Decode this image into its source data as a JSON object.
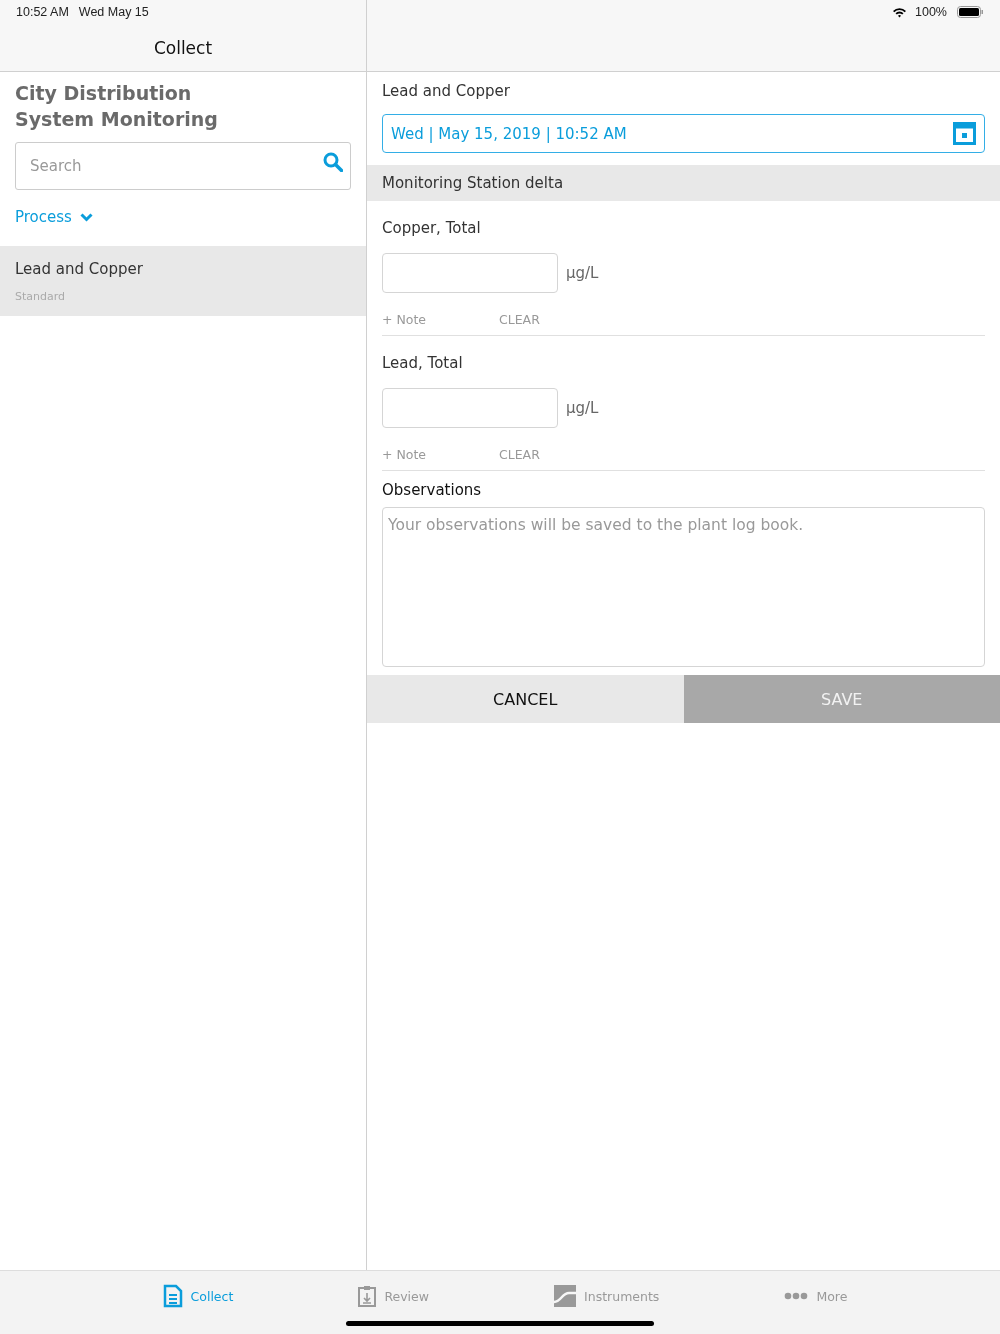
{
  "status_bar": {
    "time": "10:52 AM",
    "date": "Wed May 15",
    "battery": "100%"
  },
  "sidebar": {
    "header": "Collect",
    "title": "City Distribution System Monitoring",
    "search": {
      "placeholder": "Search"
    },
    "filter": "Process",
    "items": [
      {
        "name": "Lead and Copper",
        "subtitle": "Standard",
        "selected": true
      }
    ]
  },
  "form": {
    "title": "Lead and Copper",
    "datetime": "Wed | May 15, 2019 | 10:52 AM",
    "section": "Monitoring Station delta",
    "measurements": [
      {
        "label": "Copper, Total",
        "unit": "µg/L",
        "note": "+ Note",
        "clear": "CLEAR"
      },
      {
        "label": "Lead, Total",
        "unit": "µg/L",
        "note": "+ Note",
        "clear": "CLEAR"
      }
    ],
    "observations": {
      "label": "Observations",
      "placeholder": "Your observations will be saved to the plant log book."
    },
    "buttons": [
      {
        "label": "CANCEL",
        "kind": "cancel"
      },
      {
        "label": "SAVE",
        "kind": "save"
      }
    ]
  },
  "tab_bar": [
    {
      "label": "Collect",
      "selected": true
    },
    {
      "label": "Review",
      "selected": false
    },
    {
      "label": "Instruments",
      "selected": false
    },
    {
      "label": "More",
      "selected": false
    }
  ]
}
